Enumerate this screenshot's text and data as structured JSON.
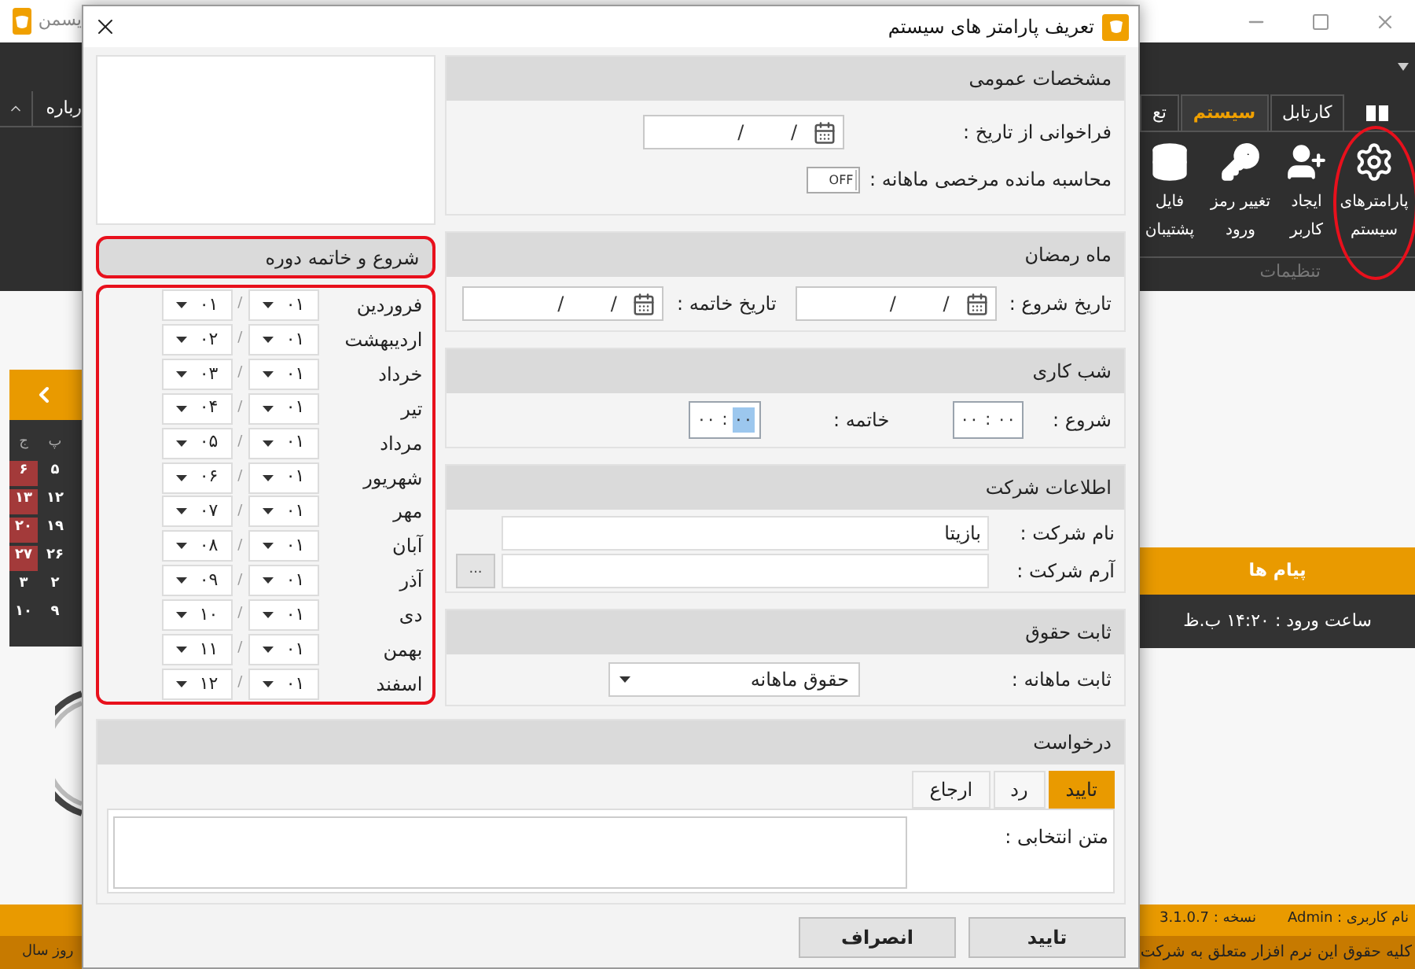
{
  "app": {
    "title": "یسمن",
    "about_tab": "رباره",
    "tabs": [
      {
        "label": "کارتابل",
        "selected": false
      },
      {
        "label": "سیستم",
        "selected": true
      },
      {
        "label": "تع",
        "selected": false
      }
    ],
    "ribbon_buttons": [
      {
        "kind": "gear",
        "label": "پارامترهای سیستم",
        "highlighted": true
      },
      {
        "kind": "user",
        "label": "ایجاد کاربر",
        "highlighted": false
      },
      {
        "kind": "key",
        "label": "تغییر رمز ورود",
        "highlighted": false
      },
      {
        "kind": "database",
        "label": "فایل پشتیبان",
        "highlighted": false
      }
    ],
    "group_label": "تنظیمات",
    "calendar": {
      "columns": [
        {
          "header": "پ",
          "days": [
            {
              "text": "۵",
              "holiday": false
            },
            {
              "text": "۱۲",
              "holiday": false
            },
            {
              "text": "۱۹",
              "holiday": false
            },
            {
              "text": "۲۶",
              "holiday": false
            },
            {
              "text": "۲",
              "holiday": false
            },
            {
              "text": "۹",
              "holiday": false
            }
          ]
        },
        {
          "header": "ج",
          "days": [
            {
              "text": "۶",
              "holiday": true
            },
            {
              "text": "۱۳",
              "holiday": true
            },
            {
              "text": "۲۰",
              "holiday": true
            },
            {
              "text": "۲۷",
              "holiday": true
            },
            {
              "text": "۳",
              "holiday": false
            },
            {
              "text": "۱۰",
              "holiday": false
            }
          ]
        }
      ]
    },
    "messages": {
      "title": "پیام ها",
      "text": "ساعت ورود : ۱۴:۲۰ ب.ظ"
    },
    "status_bar": {
      "user": "نام کاربری : Admin",
      "version": "نسخه : 3.1.0.7",
      "copyright": "کلیه حقوق این نرم افزار متعلق به شرکت",
      "left_text": "روز سال"
    }
  },
  "dialog": {
    "title": "تعریف پارامتر های سیستم",
    "general": {
      "title": "مشخصات عمومی",
      "recall": {
        "label": "فراخوانی از تاریخ :",
        "value": "/ /"
      },
      "leave": {
        "label": "محاسبه مانده مرخصی ماهانه :",
        "toggle_text": "OFF",
        "on": false
      }
    },
    "ramadan": {
      "title": "ماه رمضان",
      "start": {
        "label": "تاریخ شروع :",
        "value": "/ /"
      },
      "end": {
        "label": "تاریخ خاتمه :",
        "value": "/ /"
      }
    },
    "night_shift": {
      "title": "شب کاری",
      "start": {
        "label": "شروع :",
        "separator": ":",
        "segments": [
          {
            "text": "۰۰",
            "selected": false
          },
          {
            "text": "۰۰",
            "selected": false
          }
        ]
      },
      "end": {
        "label": "خاتمه :",
        "separator": ":",
        "segments": [
          {
            "text": "۰۰",
            "selected": true
          },
          {
            "text": "۰۰",
            "selected": false
          }
        ]
      }
    },
    "company": {
      "title": "اطلاعات شرکت",
      "name": {
        "label": "نام شرکت :",
        "value": "بازیتا"
      },
      "logo": {
        "label": "آرم شرکت :",
        "browse": "..."
      }
    },
    "salary": {
      "title": "ثابت حقوق",
      "label": "ثابت ماهانه :",
      "value": "حقوق ماهانه"
    },
    "period": {
      "title": "شروع و خاتمه دوره",
      "highlighted": true,
      "months": [
        {
          "name": "فروردین",
          "day": "۰۱",
          "separator": "/",
          "month": "۰۱"
        },
        {
          "name": "اردیبهشت",
          "day": "۰۱",
          "separator": "/",
          "month": "۰۲"
        },
        {
          "name": "خرداد",
          "day": "۰۱",
          "separator": "/",
          "month": "۰۳"
        },
        {
          "name": "تیر",
          "day": "۰۱",
          "separator": "/",
          "month": "۰۴"
        },
        {
          "name": "مرداد",
          "day": "۰۱",
          "separator": "/",
          "month": "۰۵"
        },
        {
          "name": "شهریور",
          "day": "۰۱",
          "separator": "/",
          "month": "۰۶"
        },
        {
          "name": "مهر",
          "day": "۰۱",
          "separator": "/",
          "month": "۰۷"
        },
        {
          "name": "آبان",
          "day": "۰۱",
          "separator": "/",
          "month": "۰۸"
        },
        {
          "name": "آذر",
          "day": "۰۱",
          "separator": "/",
          "month": "۰۹"
        },
        {
          "name": "دی",
          "day": "۰۱",
          "separator": "/",
          "month": "۱۰"
        },
        {
          "name": "بهمن",
          "day": "۰۱",
          "separator": "/",
          "month": "۱۱"
        },
        {
          "name": "اسفند",
          "day": "۰۱",
          "separator": "/",
          "month": "۱۲"
        }
      ]
    },
    "request": {
      "title": "درخواست",
      "tabs": [
        {
          "label": "تایید",
          "selected": true
        },
        {
          "label": "رد",
          "selected": false
        },
        {
          "label": "ارجاع",
          "selected": false
        }
      ],
      "text_label": "متن انتخابی :"
    },
    "buttons": [
      "تایید",
      "انصراف"
    ]
  }
}
